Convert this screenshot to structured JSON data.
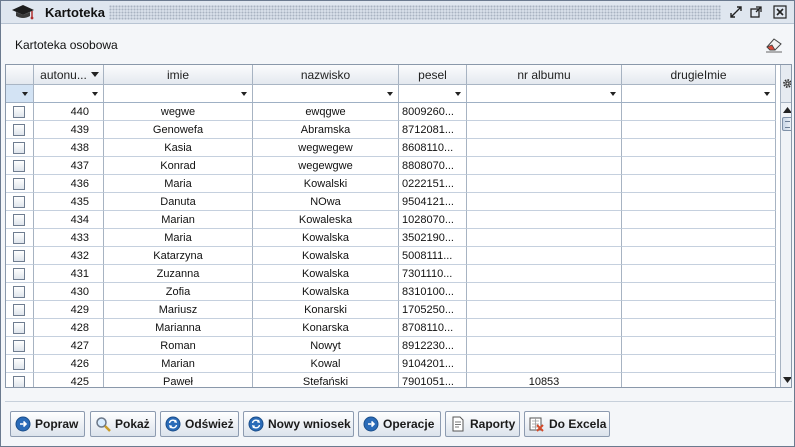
{
  "window": {
    "title": "Kartoteka",
    "icon": "graduation-cap-icon",
    "controls": [
      "minimize-icon",
      "maximize-icon",
      "close-icon"
    ]
  },
  "panel": {
    "title": "Kartoteka osobowa",
    "clear_icon": "eraser-icon"
  },
  "grid": {
    "columns": [
      "autonu...",
      "imie",
      "nazwisko",
      "pesel",
      "nr albumu",
      "drugieImie"
    ],
    "settings_icon": "gear-icon",
    "rows": [
      {
        "id": "440",
        "imie": "wegwe",
        "nazwisko": "ewqgwe",
        "pesel": "8009260...",
        "nr_albumu": "",
        "drugie": ""
      },
      {
        "id": "439",
        "imie": "Genowefa",
        "nazwisko": "Abramska",
        "pesel": "8712081...",
        "nr_albumu": "",
        "drugie": ""
      },
      {
        "id": "438",
        "imie": "Kasia",
        "nazwisko": "wegwegew",
        "pesel": "8608110...",
        "nr_albumu": "",
        "drugie": ""
      },
      {
        "id": "437",
        "imie": "Konrad",
        "nazwisko": "wegewgwe",
        "pesel": "8808070...",
        "nr_albumu": "",
        "drugie": ""
      },
      {
        "id": "436",
        "imie": "Maria",
        "nazwisko": "Kowalski",
        "pesel": "0222151...",
        "nr_albumu": "",
        "drugie": ""
      },
      {
        "id": "435",
        "imie": "Danuta",
        "nazwisko": "NOwa",
        "pesel": "9504121...",
        "nr_albumu": "",
        "drugie": ""
      },
      {
        "id": "434",
        "imie": "Marian",
        "nazwisko": "Kowaleska",
        "pesel": "1028070...",
        "nr_albumu": "",
        "drugie": ""
      },
      {
        "id": "433",
        "imie": "Maria",
        "nazwisko": "Kowalska",
        "pesel": "3502190...",
        "nr_albumu": "",
        "drugie": ""
      },
      {
        "id": "432",
        "imie": "Katarzyna",
        "nazwisko": "Kowalska",
        "pesel": "5008111...",
        "nr_albumu": "",
        "drugie": ""
      },
      {
        "id": "431",
        "imie": "Zuzanna",
        "nazwisko": "Kowalska",
        "pesel": "7301110...",
        "nr_albumu": "",
        "drugie": ""
      },
      {
        "id": "430",
        "imie": "Zofia",
        "nazwisko": "Kowalska",
        "pesel": "8310100...",
        "nr_albumu": "",
        "drugie": ""
      },
      {
        "id": "429",
        "imie": "Mariusz",
        "nazwisko": "Konarski",
        "pesel": "1705250...",
        "nr_albumu": "",
        "drugie": ""
      },
      {
        "id": "428",
        "imie": "Marianna",
        "nazwisko": "Konarska",
        "pesel": "8708110...",
        "nr_albumu": "",
        "drugie": ""
      },
      {
        "id": "427",
        "imie": "Roman",
        "nazwisko": "Nowyt",
        "pesel": "8912230...",
        "nr_albumu": "",
        "drugie": ""
      },
      {
        "id": "426",
        "imie": "Marian",
        "nazwisko": "Kowal",
        "pesel": "9104201...",
        "nr_albumu": "",
        "drugie": ""
      },
      {
        "id": "425",
        "imie": "Paweł",
        "nazwisko": "Stefański",
        "pesel": "7901051...",
        "nr_albumu": "10853",
        "drugie": ""
      }
    ]
  },
  "toolbar": {
    "popraw": "Popraw",
    "pokaz": "Pokaż",
    "odswiez": "Odśwież",
    "nowy_wniosek": "Nowy wniosek",
    "operacje": "Operacje",
    "raporty": "Raporty",
    "do_excela": "Do Excela"
  },
  "colors": {
    "accent_blue": "#2a6bb8",
    "header_bg": "#dfe6ef",
    "grid_line": "#a7b3c2"
  }
}
